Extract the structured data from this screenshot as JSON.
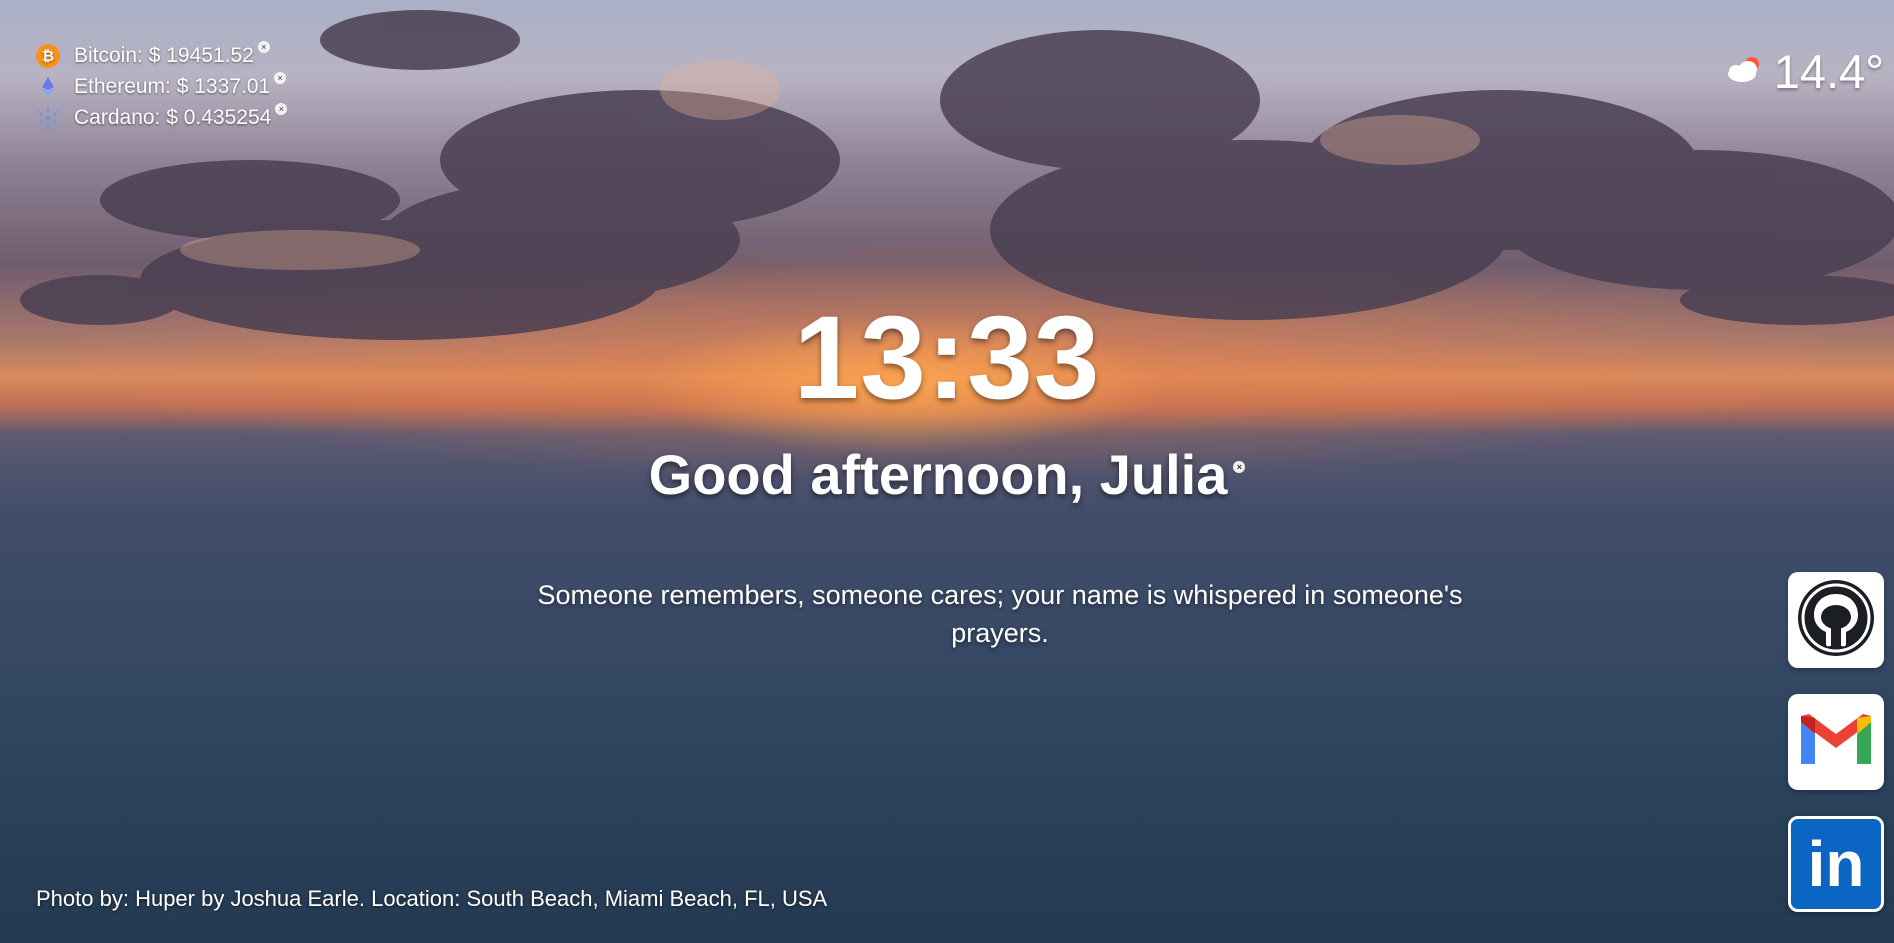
{
  "crypto": [
    {
      "name": "Bitcoin",
      "label": "Bitcoin: $ 19451.52",
      "icon": "bitcoin-icon",
      "color": "#f7931a"
    },
    {
      "name": "Ethereum",
      "label": "Ethereum: $ 1337.01",
      "icon": "ethereum-icon",
      "color": "#627eea"
    },
    {
      "name": "Cardano",
      "label": "Cardano: $ 0.435254",
      "icon": "cardano-icon",
      "color": "#3468d1"
    }
  ],
  "remove_glyph": "×",
  "weather": {
    "temperature": "14.4°",
    "icon": "partly-cloudy-sun-icon"
  },
  "clock": {
    "time": "13:33"
  },
  "greeting": {
    "text": "Good afternoon, Julia"
  },
  "quote": {
    "text": "Someone remembers, someone cares; your name is whispered in someone's prayers."
  },
  "socials": [
    {
      "name": "GitHub",
      "icon": "github-icon"
    },
    {
      "name": "Gmail",
      "icon": "gmail-icon"
    },
    {
      "name": "LinkedIn",
      "icon": "linkedin-icon",
      "glyph": "in"
    }
  ],
  "credit": {
    "text": "Photo by: Huper by Joshua Earle. Location: South Beach, Miami Beach, FL, USA"
  }
}
